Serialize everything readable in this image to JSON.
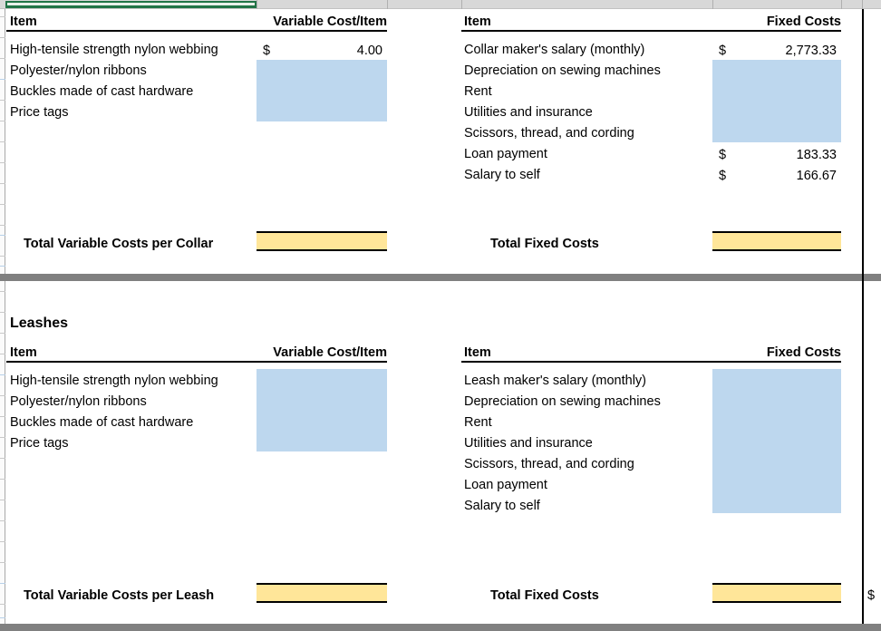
{
  "app": {
    "type": "spreadsheet",
    "accent_green": "#217346",
    "fill_blue": "#bdd7ee",
    "fill_yellow": "#ffe699",
    "pane_divider": "#808080"
  },
  "sections": [
    {
      "id": "collars",
      "title": "",
      "variable": {
        "header_item": "Item",
        "header_value": "Variable Cost/Item",
        "rows": [
          {
            "label": "High-tensile strength nylon webbing",
            "currency": "$",
            "value": "4.00"
          },
          {
            "label": "Polyester/nylon ribbons",
            "currency": "",
            "value": ""
          },
          {
            "label": "Buckles made of cast hardware",
            "currency": "",
            "value": ""
          },
          {
            "label": "Price tags",
            "currency": "",
            "value": ""
          }
        ],
        "total_label": "Total Variable Costs per Collar",
        "total_value": ""
      },
      "fixed": {
        "header_item": "Item",
        "header_value": "Fixed Costs",
        "rows": [
          {
            "label": "Collar maker's salary (monthly)",
            "currency": "$",
            "value": "2,773.33"
          },
          {
            "label": "Depreciation on sewing machines",
            "currency": "",
            "value": ""
          },
          {
            "label": "Rent",
            "currency": "",
            "value": ""
          },
          {
            "label": "Utilities and insurance",
            "currency": "",
            "value": ""
          },
          {
            "label": "Scissors, thread, and cording",
            "currency": "",
            "value": ""
          },
          {
            "label": "Loan payment",
            "currency": "$",
            "value": "183.33"
          },
          {
            "label": "Salary to self",
            "currency": "$",
            "value": "166.67"
          }
        ],
        "total_label": "Total Fixed Costs",
        "total_value": ""
      }
    },
    {
      "id": "leashes",
      "title": "Leashes",
      "variable": {
        "header_item": "Item",
        "header_value": "Variable Cost/Item",
        "rows": [
          {
            "label": "High-tensile strength nylon webbing",
            "currency": "",
            "value": ""
          },
          {
            "label": "Polyester/nylon ribbons",
            "currency": "",
            "value": ""
          },
          {
            "label": "Buckles made of cast hardware",
            "currency": "",
            "value": ""
          },
          {
            "label": "Price tags",
            "currency": "",
            "value": ""
          }
        ],
        "total_label": "Total Variable Costs per Leash",
        "total_value": ""
      },
      "fixed": {
        "header_item": "Item",
        "header_value": "Fixed Costs",
        "rows": [
          {
            "label": "Leash maker's salary (monthly)",
            "currency": "",
            "value": ""
          },
          {
            "label": "Depreciation on sewing machines",
            "currency": "",
            "value": ""
          },
          {
            "label": "Rent",
            "currency": "",
            "value": ""
          },
          {
            "label": "Utilities and insurance",
            "currency": "",
            "value": ""
          },
          {
            "label": "Scissors, thread, and cording",
            "currency": "",
            "value": ""
          },
          {
            "label": "Loan payment",
            "currency": "",
            "value": ""
          },
          {
            "label": "Salary to self",
            "currency": "",
            "value": ""
          }
        ],
        "total_label": "Total Fixed Costs",
        "total_value": ""
      }
    }
  ],
  "offsheet": {
    "trailing_currency": "$"
  }
}
